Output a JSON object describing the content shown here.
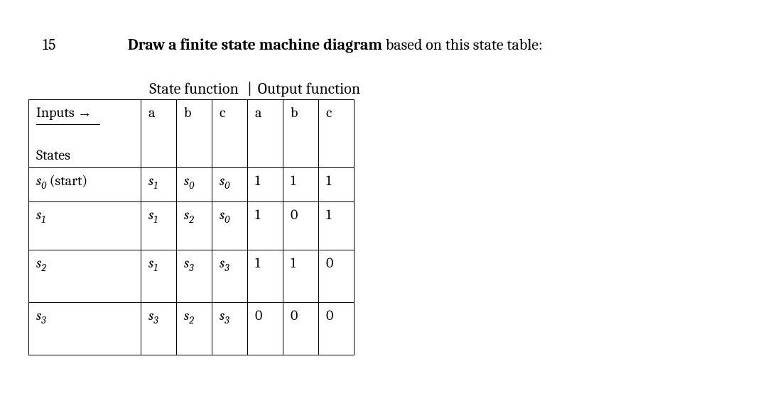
{
  "question_number": "15",
  "prompt_bold": "Draw a finite state machine diagram",
  "prompt_rest": " based on this state table:",
  "group_headers": {
    "state_fn": "State function",
    "output_fn": "Output function"
  },
  "header_cell": {
    "inputs": "Inputs",
    "arrow": "→",
    "states": "States"
  },
  "input_cols": [
    "a",
    "b",
    "c",
    "a",
    "b",
    "c"
  ],
  "rows": [
    {
      "state": {
        "s": "s",
        "sub": "0",
        "suffix": " (start)"
      },
      "cells": [
        {
          "s": "s",
          "sub": "1"
        },
        {
          "s": "s",
          "sub": "0"
        },
        {
          "s": "s",
          "sub": "0"
        },
        {
          "text": "1"
        },
        {
          "text": "1"
        },
        {
          "text": "1"
        }
      ]
    },
    {
      "state": {
        "s": "s",
        "sub": "1",
        "suffix": ""
      },
      "cells": [
        {
          "s": "s",
          "sub": "1"
        },
        {
          "s": "s",
          "sub": "2"
        },
        {
          "s": "s",
          "sub": "0"
        },
        {
          "text": "1"
        },
        {
          "text": "0"
        },
        {
          "text": "1"
        }
      ]
    },
    {
      "state": {
        "s": "s",
        "sub": "2",
        "suffix": ""
      },
      "cells": [
        {
          "s": "s",
          "sub": "1"
        },
        {
          "s": "s",
          "sub": "3"
        },
        {
          "s": "s",
          "sub": "3"
        },
        {
          "text": "1"
        },
        {
          "text": "1"
        },
        {
          "text": "0"
        }
      ]
    },
    {
      "state": {
        "s": "s",
        "sub": "3",
        "suffix": ""
      },
      "cells": [
        {
          "s": "s",
          "sub": "3"
        },
        {
          "s": "s",
          "sub": "2"
        },
        {
          "s": "s",
          "sub": "3"
        },
        {
          "text": "0"
        },
        {
          "text": "0"
        },
        {
          "text": "0"
        }
      ]
    }
  ]
}
